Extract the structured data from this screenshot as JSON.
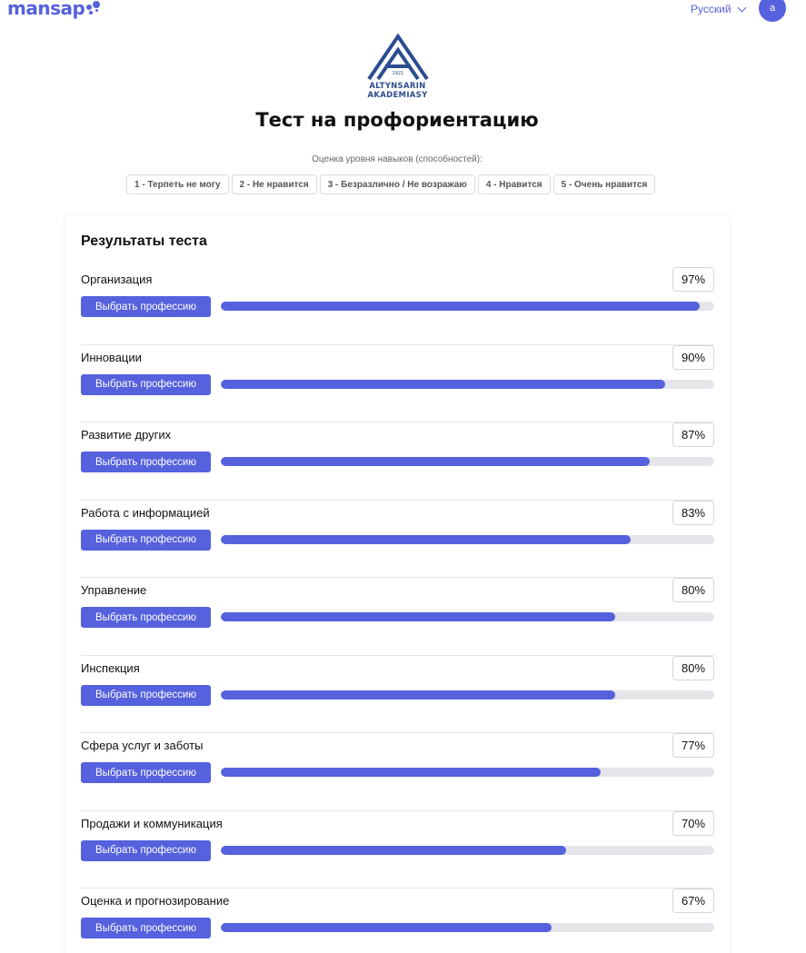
{
  "header": {
    "brand": "mansap",
    "language": "Русский",
    "avatar_letter": "a",
    "accent_color": "#5561dd"
  },
  "logo": {
    "year": "1921",
    "line1": "ALTYNSARIN",
    "line2": "AKADEMIASY"
  },
  "page_title": "Тест на профориентацию",
  "scale": {
    "caption": "Оценка уровня навыков (способностей):",
    "options": [
      "1 - Терпеть не могу",
      "2 - Не нравится",
      "3 - Безразлично / Не возражаю",
      "4 - Нравится",
      "5 - Очень нравится"
    ]
  },
  "results": {
    "title": "Результаты теста",
    "button_label": "Выбрать профессию",
    "items": [
      {
        "label": "Организация",
        "percent_text": "97%",
        "fill": 0.97
      },
      {
        "label": "Инновации",
        "percent_text": "90%",
        "fill": 0.9
      },
      {
        "label": "Развитие других",
        "percent_text": "87%",
        "fill": 0.87
      },
      {
        "label": "Работа с информацией",
        "percent_text": "83%",
        "fill": 0.83
      },
      {
        "label": "Управление",
        "percent_text": "80%",
        "fill": 0.8
      },
      {
        "label": "Инспекция",
        "percent_text": "80%",
        "fill": 0.8
      },
      {
        "label": "Сфера услуг и заботы",
        "percent_text": "77%",
        "fill": 0.77
      },
      {
        "label": "Продажи и коммуникация",
        "percent_text": "70%",
        "fill": 0.7
      },
      {
        "label": "Оценка и прогнозирование",
        "percent_text": "67%",
        "fill": 0.67
      }
    ]
  }
}
